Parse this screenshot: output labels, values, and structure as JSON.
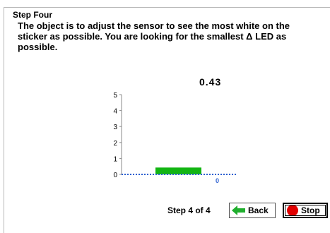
{
  "group": {
    "title": "Step Four"
  },
  "instructions": "The object is to adjust the sensor to see the most white on the sticker as possible.  You are looking for the smallest Δ LED as possible.",
  "readout": "0.43",
  "chart_data": {
    "type": "bar",
    "values": [
      0.43
    ],
    "ylim": [
      0,
      5
    ],
    "yticks": [
      "0",
      "1",
      "2",
      "3",
      "4",
      "5"
    ],
    "baseline_label": "0",
    "colors": {
      "bar": "#13b513",
      "baseline": "#2b5fd0"
    }
  },
  "footer": {
    "step_text": "Step 4 of 4",
    "back_label": "Back",
    "stop_label": "Stop"
  },
  "icons": {
    "back": "left-arrow-icon",
    "stop": "stop-circle-icon"
  },
  "colors": {
    "back_arrow": "#1fae2d",
    "stop_circle": "#e00000"
  }
}
